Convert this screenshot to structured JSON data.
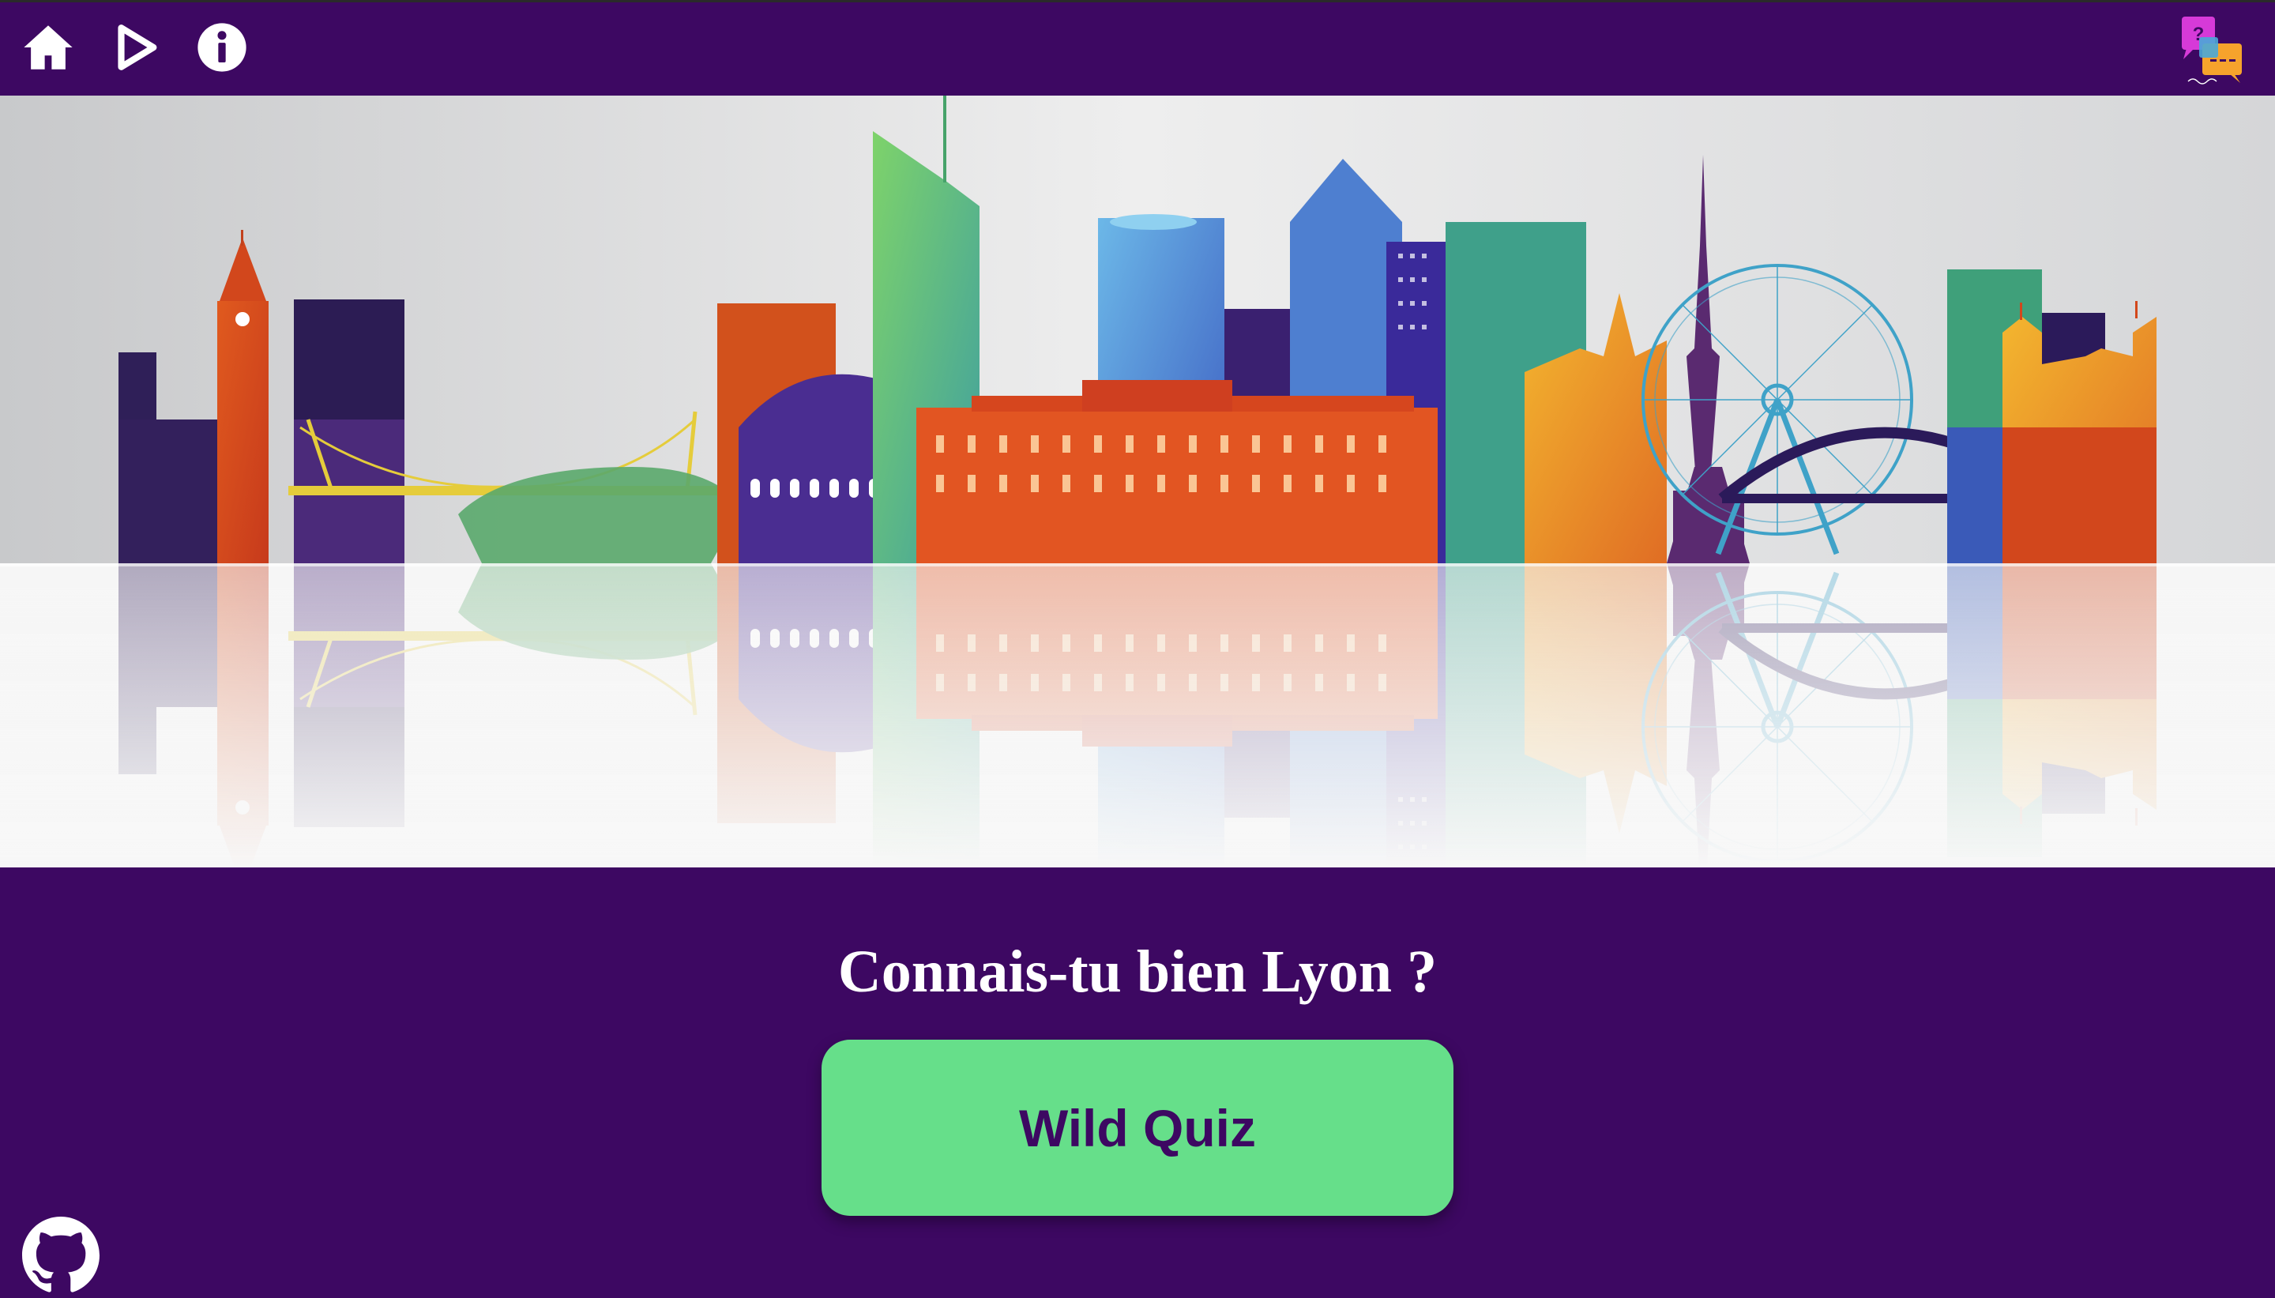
{
  "topbar": {
    "home_icon": "home-icon",
    "play_icon": "play-icon",
    "info_icon": "info-icon",
    "logo_icon": "wild-quiz-logo"
  },
  "hero": {
    "image": "lyon-skyline-illustration"
  },
  "main": {
    "headline": "Connais-tu bien Lyon ?",
    "cta_label": "Wild Quiz"
  },
  "footer": {
    "github_icon": "github-icon"
  },
  "colors": {
    "background": "#3d0862",
    "cta": "#66df8a",
    "cta_text": "#3d0862",
    "text": "#ffffff"
  }
}
